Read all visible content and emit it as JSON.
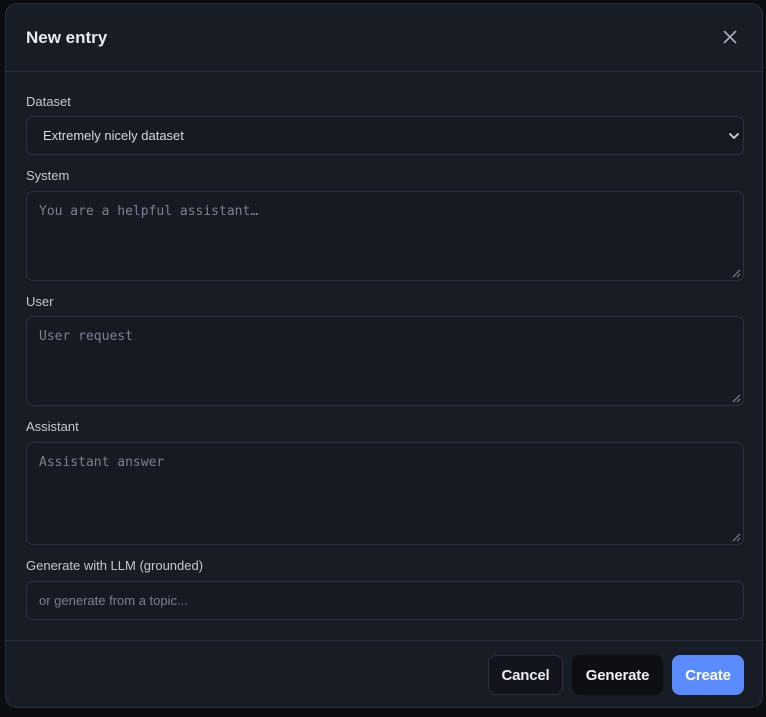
{
  "modal": {
    "title": "New entry",
    "close_icon": "close-icon"
  },
  "fields": {
    "dataset": {
      "label": "Dataset",
      "selected": "Extremely nicely dataset",
      "icon": "chevron-down-icon"
    },
    "system": {
      "label": "System",
      "value": "",
      "placeholder": "You are a helpful assistant…"
    },
    "user": {
      "label": "User",
      "value": "",
      "placeholder": "User request"
    },
    "assistant": {
      "label": "Assistant",
      "value": "",
      "placeholder": "Assistant answer"
    },
    "generate": {
      "label": "Generate with LLM (grounded)",
      "value": "",
      "placeholder": "or generate from a topic..."
    }
  },
  "footer": {
    "cancel_label": "Cancel",
    "generate_label": "Generate",
    "create_label": "Create"
  },
  "colors": {
    "accent": "#5b8cff",
    "background": "#181c24",
    "control_bg": "#161a22",
    "border": "#2d323d"
  }
}
